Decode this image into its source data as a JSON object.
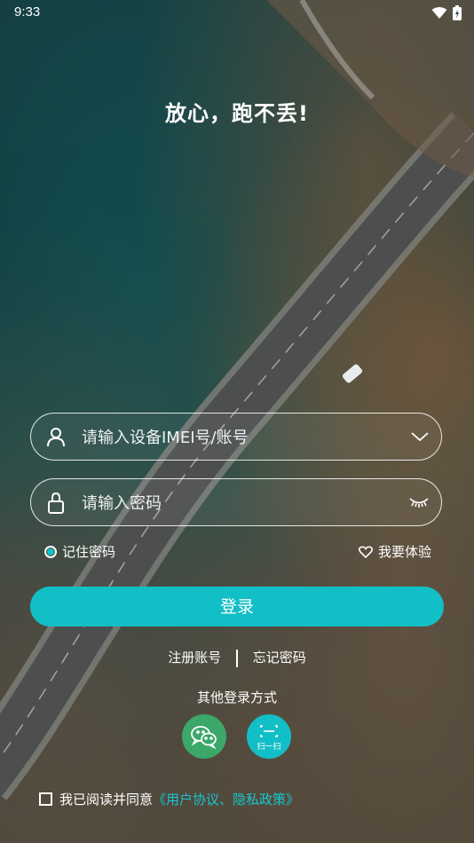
{
  "status_bar": {
    "time": "9:33"
  },
  "slogan": "放心，跑不丢!",
  "account_field": {
    "placeholder": "请输入设备IMEI号/账号",
    "value": ""
  },
  "password_field": {
    "placeholder": "请输入密码",
    "value": ""
  },
  "remember_password": {
    "label": "记住密码",
    "checked": true
  },
  "trial": {
    "label": "我要体验"
  },
  "login_button": {
    "label": "登录"
  },
  "links": {
    "register": "注册账号",
    "forgot": "忘记密码"
  },
  "other_login": {
    "title": "其他登录方式",
    "wechat_icon": "wechat-icon",
    "scan_label": "扫一扫"
  },
  "agreement": {
    "prefix": "我已阅读并同意",
    "link": "《用户协议、隐私政策》",
    "checked": false
  },
  "colors": {
    "accent": "#13bfc6",
    "wechat": "#3ba86a",
    "link": "#16c6cf"
  }
}
